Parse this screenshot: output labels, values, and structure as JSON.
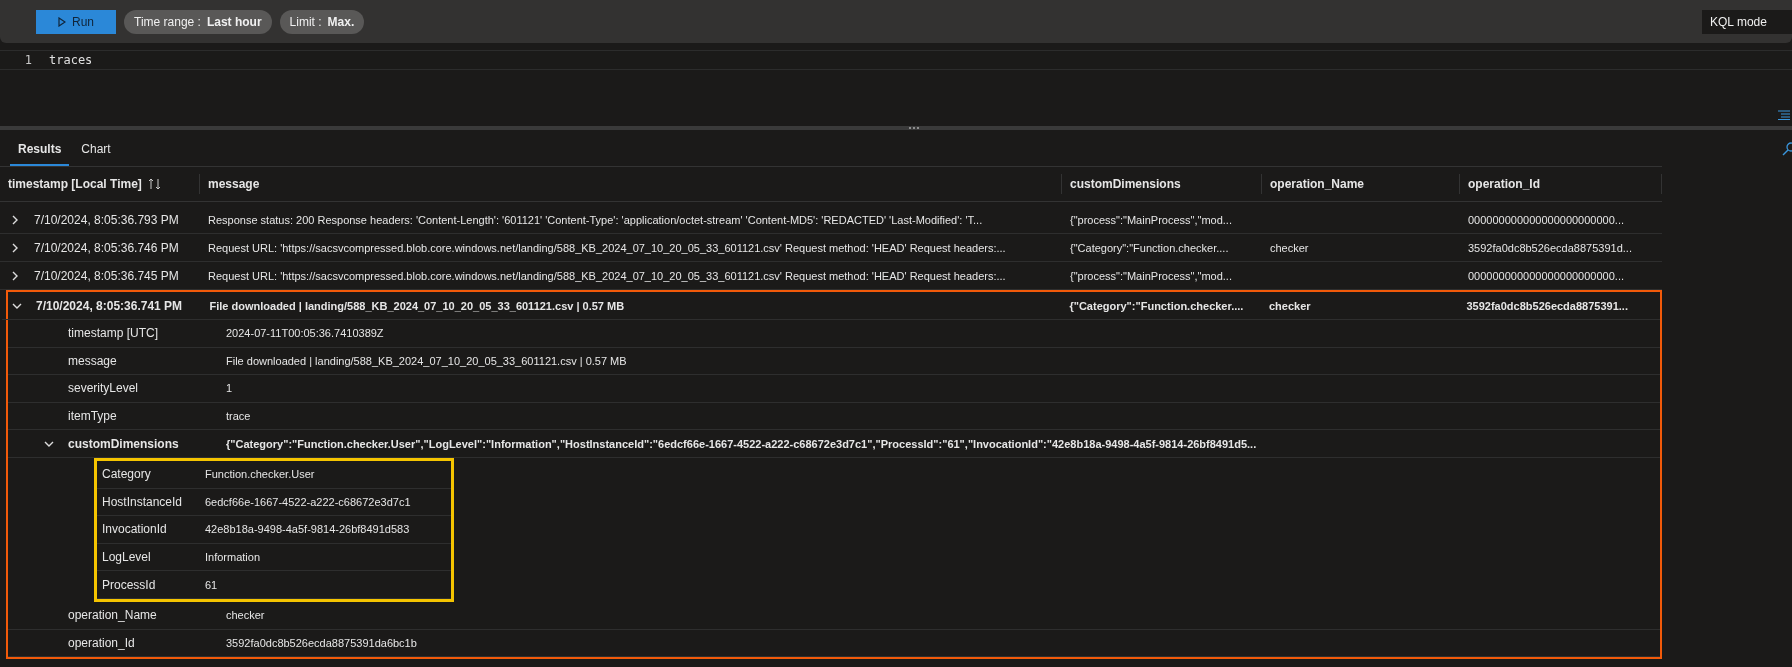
{
  "toolbar": {
    "run_button": "Run",
    "time_range": {
      "label": "Time range :",
      "value": "Last hour"
    },
    "limit": {
      "label": "Limit :",
      "value": "Max."
    },
    "mode": "KQL mode"
  },
  "editor": {
    "lines": [
      {
        "number": "1",
        "code": "traces"
      }
    ]
  },
  "tabs": [
    {
      "label": "Results",
      "selected": true
    },
    {
      "label": "Chart",
      "selected": false
    }
  ],
  "table": {
    "columns": [
      {
        "label": "timestamp [Local Time]",
        "sortable": true
      },
      {
        "label": "message",
        "sortable": false
      },
      {
        "label": "customDimensions",
        "sortable": false
      },
      {
        "label": "operation_Name",
        "sortable": false
      },
      {
        "label": "operation_Id",
        "sortable": false
      }
    ],
    "rows": [
      {
        "expanded": false,
        "highlighted": false,
        "cells": [
          "7/10/2024, 8:05:36.793 PM",
          "Response status: 200 Response headers: 'Content-Length': '601121' 'Content-Type': 'application/octet-stream' 'Content-MD5': 'REDACTED' 'Last-Modified': 'T...",
          "{\"process\":\"MainProcess\",\"mod...",
          "",
          "000000000000000000000000..."
        ]
      },
      {
        "expanded": false,
        "highlighted": false,
        "cells": [
          "7/10/2024, 8:05:36.746 PM",
          "Request URL: 'https://sacsvcompressed.blob.core.windows.net/landing/588_KB_2024_07_10_20_05_33_601121.csv' Request method: 'HEAD' Request headers:...",
          "{\"Category\":\"Function.checker....",
          "checker",
          "3592fa0dc8b526ecda8875391d..."
        ]
      },
      {
        "expanded": false,
        "highlighted": false,
        "cells": [
          "7/10/2024, 8:05:36.745 PM",
          "Request URL: 'https://sacsvcompressed.blob.core.windows.net/landing/588_KB_2024_07_10_20_05_33_601121.csv' Request method: 'HEAD' Request headers:...",
          "{\"process\":\"MainProcess\",\"mod...",
          "",
          "000000000000000000000000..."
        ]
      },
      {
        "expanded": true,
        "highlighted": true,
        "cells": [
          "7/10/2024, 8:05:36.741 PM",
          "File downloaded | landing/588_KB_2024_07_10_20_05_33_601121.csv | 0.57 MB",
          "{\"Category\":\"Function.checker....",
          "checker",
          "3592fa0dc8b526ecda8875391..."
        ],
        "details": [
          {
            "name": "timestamp [UTC]",
            "value": "2024-07-11T00:05:36.7410389Z"
          },
          {
            "name": "message",
            "value": "File downloaded | landing/588_KB_2024_07_10_20_05_33_601121.csv | 0.57 MB"
          },
          {
            "name": "severityLevel",
            "value": "1"
          },
          {
            "name": "itemType",
            "value": "trace"
          },
          {
            "name": "customDimensions",
            "value": "{\"Category\":\"Function.checker.User\",\"LogLevel\":\"Information\",\"HostInstanceId\":\"6edcf66e-1667-4522-a222-c68672e3d7c1\",\"ProcessId\":\"61\",\"InvocationId\":\"42e8b18a-9498-4a5f-9814-26bf8491d5...",
            "expanded": true,
            "boxed": true,
            "children": [
              {
                "name": "Category",
                "value": "Function.checker.User"
              },
              {
                "name": "HostInstanceId",
                "value": "6edcf66e-1667-4522-a222-c68672e3d7c1"
              },
              {
                "name": "InvocationId",
                "value": "42e8b18a-9498-4a5f-9814-26bf8491d583"
              },
              {
                "name": "LogLevel",
                "value": "Information"
              },
              {
                "name": "ProcessId",
                "value": "61"
              }
            ]
          },
          {
            "name": "operation_Name",
            "value": "checker"
          },
          {
            "name": "operation_Id",
            "value": "3592fa0dc8b526ecda8875391da6bc1b"
          }
        ]
      }
    ]
  }
}
